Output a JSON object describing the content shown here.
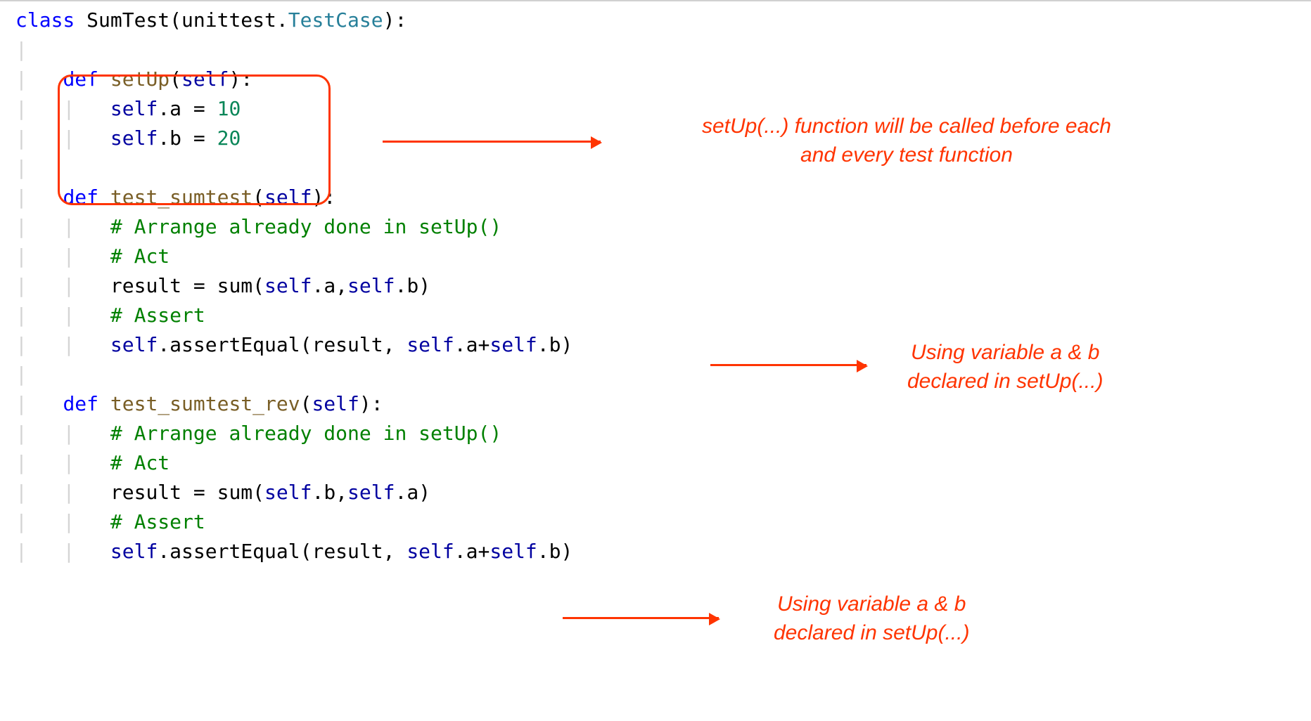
{
  "code": {
    "l1a": "class",
    "l1b": " SumTest(unittest",
    "l1c": ".",
    "l1d": "TestCase",
    "l1e": "):",
    "blank": "",
    "l3a": "def",
    "l3b": " ",
    "l3c": "setUp",
    "l3d": "(",
    "l3e": "self",
    "l3f": "):",
    "l4a": "self",
    "l4b": ".a = ",
    "l4c": "10",
    "l5a": "self",
    "l5b": ".b = ",
    "l5c": "20",
    "l7a": "def",
    "l7b": " ",
    "l7c": "test_sumtest",
    "l7d": "(",
    "l7e": "self",
    "l7f": "):",
    "l8": "# Arrange already done in setUp()",
    "l9": "# Act",
    "l10a": "result = sum(",
    "l10b": "self",
    "l10c": ".a,",
    "l10d": "self",
    "l10e": ".b)",
    "l11": "# Assert",
    "l12a": "self",
    "l12b": ".assertEqual(result, ",
    "l12c": "self",
    "l12d": ".a+",
    "l12e": "self",
    "l12f": ".b)",
    "l14a": "def",
    "l14b": " ",
    "l14c": "test_sumtest_rev",
    "l14d": "(",
    "l14e": "self",
    "l14f": "):",
    "l17a": "result = sum(",
    "l17b": "self",
    "l17c": ".b,",
    "l17d": "self",
    "l17e": ".a)"
  },
  "annot": {
    "note1a": "setUp(...) function will be called before each",
    "note1b": "and every test function",
    "note2a": "Using variable a & b",
    "note2b": "declared in setUp(...)",
    "note3a": "Using variable a & b",
    "note3b": "declared in setUp(...)"
  },
  "colors": {
    "keyword": "#0000ff",
    "class": "#267f99",
    "function": "#795e26",
    "self": "#0000a0",
    "number": "#098658",
    "comment": "#008000",
    "guide": "#d4d4d4",
    "annotation": "#ff3400"
  }
}
